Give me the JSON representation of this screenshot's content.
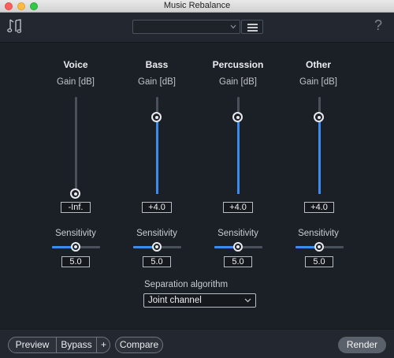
{
  "window": {
    "title": "Music Rebalance"
  },
  "header": {
    "preset_value": "",
    "icons": {
      "app": "music-note-icon",
      "menu": "hamburger-menu-icon",
      "help": "question-mark-icon"
    },
    "help_glyph": "?"
  },
  "colors": {
    "accent": "#3e8bf0",
    "background": "#1b1f26",
    "panel": "#232830"
  },
  "channels": [
    {
      "name": "Voice",
      "gain_label": "Gain [dB]",
      "gain_value": "-Inf.",
      "gain_db": null,
      "sensitivity_label": "Sensitivity",
      "sensitivity_value": "5.0"
    },
    {
      "name": "Bass",
      "gain_label": "Gain [dB]",
      "gain_value": "+4.0",
      "gain_db": 4.0,
      "sensitivity_label": "Sensitivity",
      "sensitivity_value": "5.0"
    },
    {
      "name": "Percussion",
      "gain_label": "Gain [dB]",
      "gain_value": "+4.0",
      "gain_db": 4.0,
      "sensitivity_label": "Sensitivity",
      "sensitivity_value": "5.0"
    },
    {
      "name": "Other",
      "gain_label": "Gain [dB]",
      "gain_value": "+4.0",
      "gain_db": 4.0,
      "sensitivity_label": "Sensitivity",
      "sensitivity_value": "5.0"
    }
  ],
  "separation": {
    "label": "Separation algorithm",
    "value": "Joint channel"
  },
  "footer": {
    "preview": "Preview",
    "bypass": "Bypass",
    "plus": "+",
    "compare": "Compare",
    "render": "Render"
  }
}
